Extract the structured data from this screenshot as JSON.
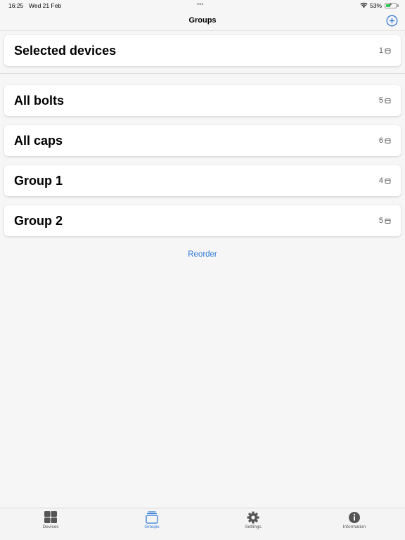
{
  "status_bar": {
    "time": "16:25",
    "date": "Wed 21 Feb",
    "battery_percent": "53%",
    "battery_level": 0.53
  },
  "nav": {
    "title": "Groups",
    "add_icon": "plus-circle-icon"
  },
  "groups": [
    {
      "label": "Selected devices",
      "count": "1"
    },
    {
      "label": "All bolts",
      "count": "5"
    },
    {
      "label": "All caps",
      "count": "6"
    },
    {
      "label": "Group 1",
      "count": "4"
    },
    {
      "label": "Group 2",
      "count": "5"
    }
  ],
  "reorder_label": "Reorder",
  "tabs": [
    {
      "label": "Devices",
      "icon": "grid-icon",
      "active": false
    },
    {
      "label": "Groups",
      "icon": "stack-icon",
      "active": true
    },
    {
      "label": "Settings",
      "icon": "gear-icon",
      "active": false
    },
    {
      "label": "Information",
      "icon": "info-icon",
      "active": false
    }
  ],
  "colors": {
    "accent": "#2f7ad8",
    "inactive_tab": "#555555",
    "battery": "#34c759"
  }
}
